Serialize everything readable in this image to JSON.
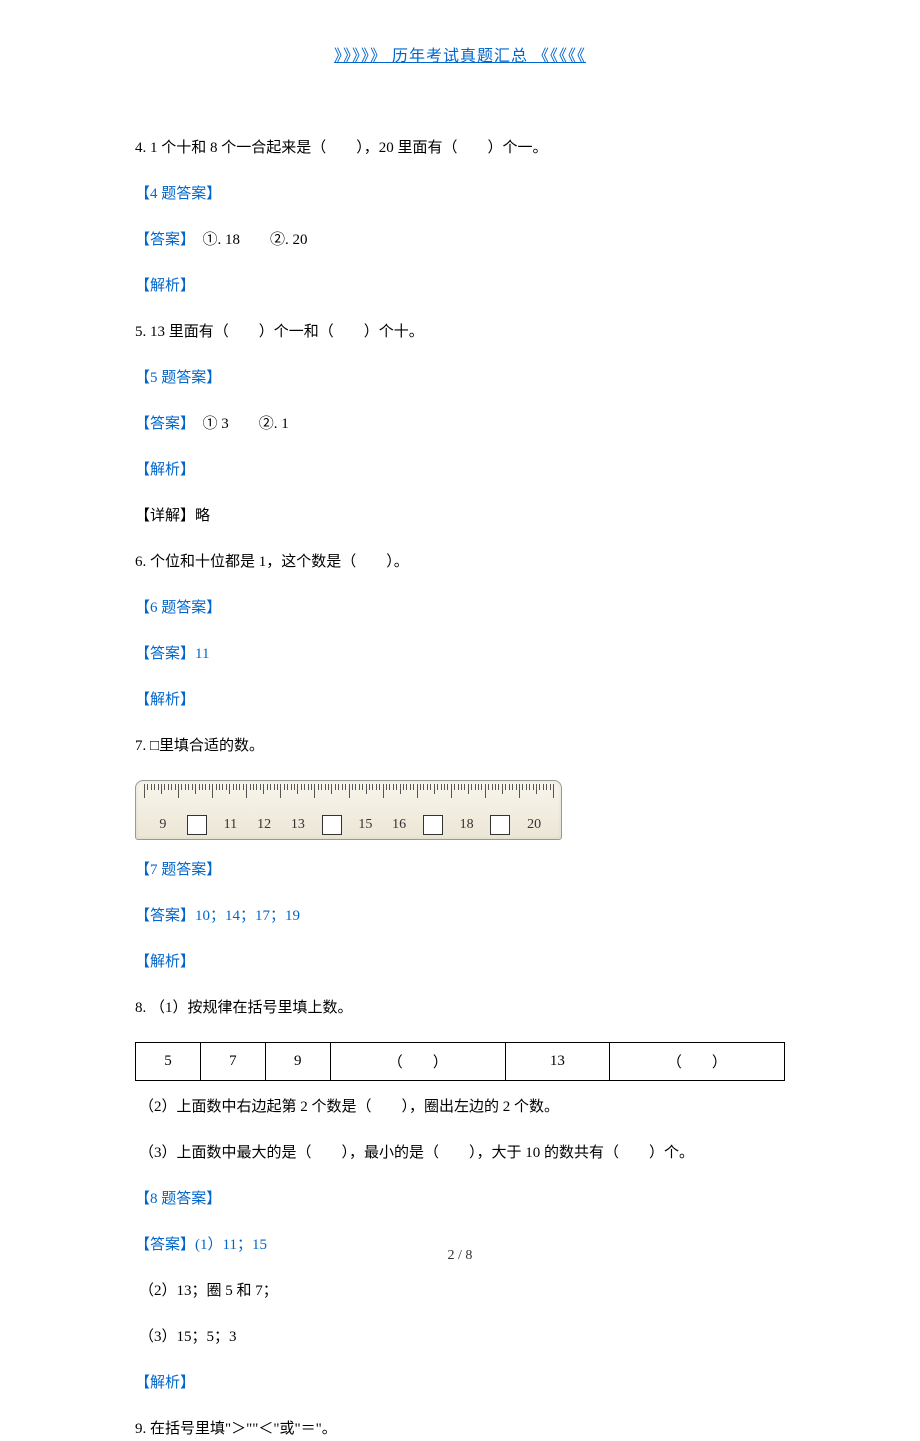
{
  "header_link": "》》》》》 历年考试真题汇总 《《《《《",
  "q4": {
    "text": "4. 1 个十和 8 个一合起来是（　　），20 里面有（　　）个一。",
    "ans_label": "【4 题答案】",
    "answer_label": "【答案】",
    "answer_text": "　①. 18　　②. 20",
    "analysis_label": "【解析】"
  },
  "q5": {
    "text": "5. 13 里面有（　　）个一和（　　）个十。",
    "ans_label": "【5 题答案】",
    "answer_label": "【答案】",
    "answer_text": "　① 3　　②. 1",
    "analysis_label": "【解析】",
    "detail_label": "【详解】略"
  },
  "q6": {
    "text": "6. 个位和十位都是 1，这个数是（　　）。",
    "ans_label": "【6 题答案】",
    "answer_full": "【答案】11",
    "analysis_label": "【解析】"
  },
  "q7": {
    "text": "7. □里填合适的数。",
    "ruler": [
      "9",
      "□",
      "11",
      "12",
      "13",
      "□",
      "15",
      "16",
      "□",
      "18",
      "□",
      "20"
    ],
    "ans_label": "【7 题答案】",
    "answer_full": "【答案】10；14；17；19",
    "analysis_label": "【解析】"
  },
  "q8": {
    "text": "8. （1）按规律在括号里填上数。",
    "table": [
      "5",
      "7",
      "9",
      "（　　）",
      "13",
      "（　　）"
    ],
    "sub2": "（2）上面数中右边起第 2 个数是（　　），圈出左边的 2 个数。",
    "sub3": "（3）上面数中最大的是（　　），最小的是（　　），大于 10 的数共有（　　）个。",
    "ans_label": "【8 题答案】",
    "answer1": "【答案】(1）11；15",
    "answer2": "（2）13；圈 5 和 7；",
    "answer3": "（3）15；5；3",
    "analysis_label": "【解析】"
  },
  "q9": {
    "text": "9. 在括号里填\"＞\"\"＜\"或\"＝\"。"
  },
  "footer": "2 / 8"
}
